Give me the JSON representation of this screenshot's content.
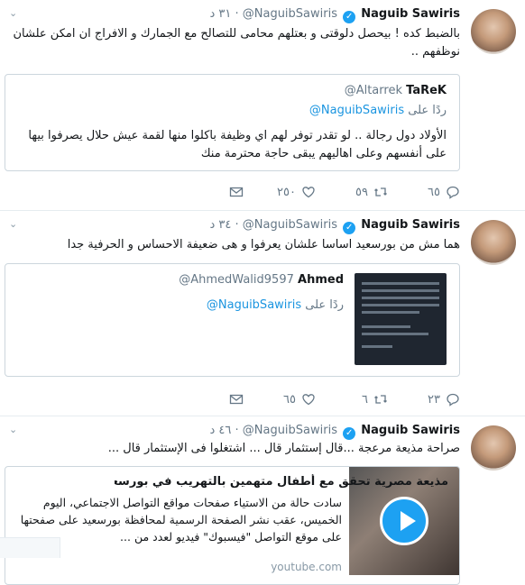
{
  "tweets": [
    {
      "name": "Naguib Sawiris",
      "handle": "@NaguibSawiris",
      "time": "٣١ د",
      "text": "بالضبط كده ! بيحصل دلوقتى و بعتلهم  محامى للتصالح مع الجمارك و الافراج ان امكن علشان نوظفهم ..",
      "quote": {
        "name": "TaReK",
        "handle": "@Altarrek",
        "reply_prefix": "ردًا على",
        "reply_handle": "@NaguibSawiris",
        "text": "الأولاد دول رجالة .. لو تقدر توفر لهم اي وظيفة باكلوا منها لقمة عيش حلال يصرفوا بيها على أنفسهم وعلى اهاليهم يبقى حاجة محترمة منك"
      },
      "actions": {
        "reply": "٦٥",
        "retweet": "٥٩",
        "like": "٢٥٠",
        "dm": ""
      }
    },
    {
      "name": "Naguib Sawiris",
      "handle": "@NaguibSawiris",
      "time": "٣٤ د",
      "text": "هما مش من بورسعيد اساسا علشان يعرفوا و هى ضعيفة الاحساس و الحرفية جدا",
      "quote": {
        "name": "Ahmed",
        "handle": "@AhmedWalid9597",
        "reply_prefix": "ردًا على",
        "reply_handle": "@NaguibSawiris"
      },
      "actions": {
        "reply": "٢٣",
        "retweet": "٦",
        "like": "٦٥",
        "dm": ""
      }
    },
    {
      "name": "Naguib Sawiris",
      "handle": "@NaguibSawiris",
      "time": "٤٦ د",
      "text": "صراحة مذيعة مرعجة ...قال إستثمار قال ... اشتغلوا فى الإستثمار قال ...",
      "card": {
        "title": "مذيعة مصرية تحقق مع أطفال متهمين بالتهريب في بورسعيد",
        "description": "سادت حالة من الاستياء صفحات مواقع التواصل الاجتماعي، اليوم الخميس، عقب نشر الصفحة الرسمية لمحافظة بورسعيد على صفحتها على موقع التواصل \"فيسبوك\" فيديو لعدد من ...",
        "domain": "youtube.com"
      }
    }
  ]
}
